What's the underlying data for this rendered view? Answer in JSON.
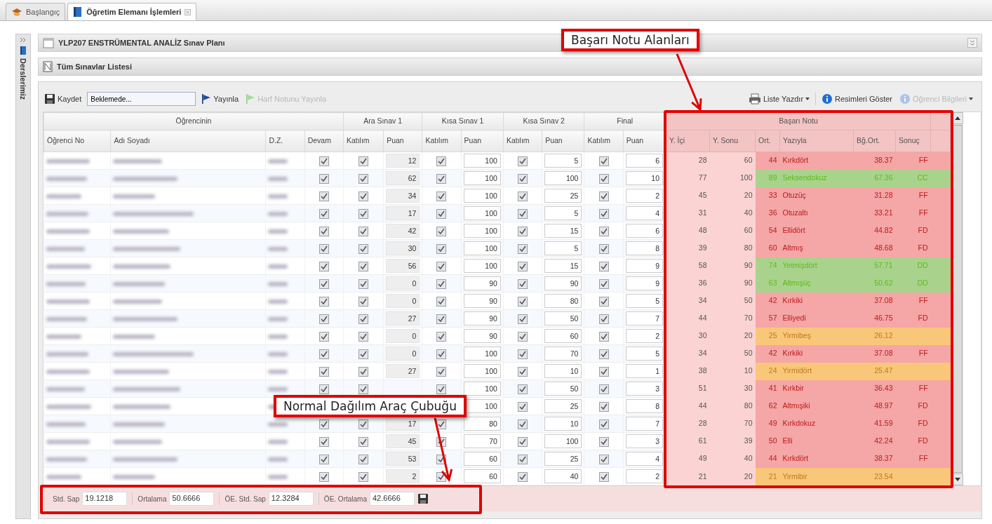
{
  "tabs": [
    {
      "label": "Başlangıç",
      "kind": "home",
      "selected": false,
      "closable": false
    },
    {
      "label": "Öğretim Elemanı İşlemleri",
      "kind": "book",
      "selected": true,
      "closable": true
    }
  ],
  "sidebar": {
    "label": "Derslerimiz"
  },
  "panel": {
    "title": "YLP207 ENSTRÜMENTAL ANALİZ Sınav Planı"
  },
  "subpanel": {
    "title": "Tüm Sınavlar Listesi"
  },
  "toolbar": {
    "left": [
      {
        "kind": "save",
        "label": "Kaydet",
        "disabled": false
      },
      {
        "kind": "status",
        "value": "Beklemede..."
      },
      {
        "kind": "flag",
        "label": "Yayınla",
        "disabled": false
      },
      {
        "kind": "flag",
        "label": "Harf Notunu Yayınla",
        "disabled": true
      }
    ],
    "right": [
      {
        "kind": "print",
        "label": "Liste Yazdır",
        "dropdown": true,
        "disabled": false
      },
      {
        "kind": "info",
        "label": "Resimleri Göster",
        "dropdown": false,
        "disabled": false
      },
      {
        "kind": "info",
        "label": "Öğrenci Bilgileri",
        "dropdown": true,
        "disabled": true
      }
    ]
  },
  "grid": {
    "groups": [
      {
        "label": "Öğrencinin",
        "columns": [
          "Öğrenci No",
          "Adı Soyadı",
          "D.Z.",
          "Devam"
        ]
      },
      {
        "label": "Ara Sınav 1",
        "columns": [
          "Katılım",
          "Puan"
        ]
      },
      {
        "label": "Kısa Sınav 1",
        "columns": [
          "Katılım",
          "Puan"
        ]
      },
      {
        "label": "Kısa Sınav 2",
        "columns": [
          "Katılım",
          "Puan"
        ]
      },
      {
        "label": "Final",
        "columns": [
          "Katılım",
          "Puan"
        ]
      },
      {
        "label": "Başarı Notu",
        "columns": [
          "Y. İçi",
          "Y. Sonu",
          "Ort.",
          "Yazıyla",
          "Bğ.Ort.",
          "Sonuç"
        ]
      }
    ],
    "rows": [
      {
        "checks": {
          "devam": true,
          "ara": true,
          "k1": true,
          "k2": true,
          "final": true
        },
        "scores": {
          "ara": "12",
          "k1": "100",
          "k2": "5",
          "final": "6"
        },
        "y_ici": "28",
        "y_sonu": "60",
        "ort": "44",
        "yaziyla": "Kırkdört",
        "bg_ort": "38.37",
        "sonuc": "FF",
        "color": "#f5a6a6"
      },
      {
        "checks": {
          "devam": true,
          "ara": true,
          "k1": true,
          "k2": true,
          "final": true
        },
        "scores": {
          "ara": "62",
          "k1": "100",
          "k2": "100",
          "final": "10"
        },
        "y_ici": "77",
        "y_sonu": "100",
        "ort": "89",
        "yaziyla": "Seksendokuz",
        "bg_ort": "67.36",
        "sonuc": "CC",
        "color": "#a9d38c"
      },
      {
        "checks": {
          "devam": true,
          "ara": true,
          "k1": true,
          "k2": true,
          "final": true
        },
        "scores": {
          "ara": "34",
          "k1": "100",
          "k2": "25",
          "final": "2"
        },
        "y_ici": "45",
        "y_sonu": "20",
        "ort": "33",
        "yaziyla": "Otuzüç",
        "bg_ort": "31.28",
        "sonuc": "FF",
        "color": "#f5a6a6"
      },
      {
        "checks": {
          "devam": true,
          "ara": true,
          "k1": true,
          "k2": true,
          "final": true
        },
        "scores": {
          "ara": "17",
          "k1": "100",
          "k2": "5",
          "final": "4"
        },
        "y_ici": "31",
        "y_sonu": "40",
        "ort": "36",
        "yaziyla": "Otuzaltı",
        "bg_ort": "33.21",
        "sonuc": "FF",
        "color": "#f5a6a6"
      },
      {
        "checks": {
          "devam": true,
          "ara": true,
          "k1": true,
          "k2": true,
          "final": true
        },
        "scores": {
          "ara": "42",
          "k1": "100",
          "k2": "15",
          "final": "6"
        },
        "y_ici": "48",
        "y_sonu": "60",
        "ort": "54",
        "yaziyla": "Ellidört",
        "bg_ort": "44.82",
        "sonuc": "FD",
        "color": "#f5a6a6"
      },
      {
        "checks": {
          "devam": true,
          "ara": true,
          "k1": true,
          "k2": true,
          "final": true
        },
        "scores": {
          "ara": "30",
          "k1": "100",
          "k2": "5",
          "final": "8"
        },
        "y_ici": "39",
        "y_sonu": "80",
        "ort": "60",
        "yaziyla": "Altmış",
        "bg_ort": "48.68",
        "sonuc": "FD",
        "color": "#f5a6a6"
      },
      {
        "checks": {
          "devam": true,
          "ara": true,
          "k1": true,
          "k2": true,
          "final": true
        },
        "scores": {
          "ara": "56",
          "k1": "100",
          "k2": "15",
          "final": "9"
        },
        "y_ici": "58",
        "y_sonu": "90",
        "ort": "74",
        "yaziyla": "Yetmişdört",
        "bg_ort": "57.71",
        "sonuc": "DD",
        "color": "#a9d38c"
      },
      {
        "checks": {
          "devam": true,
          "ara": true,
          "k1": true,
          "k2": true,
          "final": true
        },
        "scores": {
          "ara": "0",
          "k1": "90",
          "k2": "90",
          "final": "9"
        },
        "y_ici": "36",
        "y_sonu": "90",
        "ort": "63",
        "yaziyla": "Altmışüç",
        "bg_ort": "50.62",
        "sonuc": "DD",
        "color": "#a9d38c"
      },
      {
        "checks": {
          "devam": true,
          "ara": true,
          "k1": true,
          "k2": true,
          "final": true
        },
        "scores": {
          "ara": "0",
          "k1": "90",
          "k2": "80",
          "final": "5"
        },
        "y_ici": "34",
        "y_sonu": "50",
        "ort": "42",
        "yaziyla": "Kırkiki",
        "bg_ort": "37.08",
        "sonuc": "FF",
        "color": "#f5a6a6"
      },
      {
        "checks": {
          "devam": true,
          "ara": true,
          "k1": true,
          "k2": true,
          "final": true
        },
        "scores": {
          "ara": "27",
          "k1": "90",
          "k2": "50",
          "final": "7"
        },
        "y_ici": "44",
        "y_sonu": "70",
        "ort": "57",
        "yaziyla": "Elliyedi",
        "bg_ort": "46.75",
        "sonuc": "FD",
        "color": "#f5a6a6"
      },
      {
        "checks": {
          "devam": true,
          "ara": true,
          "k1": true,
          "k2": true,
          "final": true
        },
        "scores": {
          "ara": "0",
          "k1": "90",
          "k2": "60",
          "final": "2"
        },
        "y_ici": "30",
        "y_sonu": "20",
        "ort": "25",
        "yaziyla": "Yirmibeş",
        "bg_ort": "26.12",
        "color": "#f9c77a"
      },
      {
        "checks": {
          "devam": true,
          "ara": true,
          "k1": true,
          "k2": true,
          "final": true
        },
        "scores": {
          "ara": "0",
          "k1": "100",
          "k2": "70",
          "final": "5"
        },
        "y_ici": "34",
        "y_sonu": "50",
        "ort": "42",
        "yaziyla": "Kırkiki",
        "bg_ort": "37.08",
        "sonuc": "FF",
        "color": "#f5a6a6"
      },
      {
        "checks": {
          "devam": true,
          "ara": true,
          "k1": true,
          "k2": true,
          "final": true
        },
        "scores": {
          "ara": "27",
          "k1": "100",
          "k2": "10",
          "final": "1"
        },
        "y_ici": "38",
        "y_sonu": "10",
        "ort": "24",
        "yaziyla": "Yirmidört",
        "bg_ort": "25.47",
        "color": "#f9c77a"
      },
      {
        "checks": {
          "devam": true,
          "ara": true,
          "k1": true,
          "k2": true,
          "final": true
        },
        "scores": {
          "k1": "100",
          "k2": "50",
          "final": "3"
        },
        "y_ici": "51",
        "y_sonu": "30",
        "ort": "41",
        "yaziyla": "Kırkbir",
        "bg_ort": "36.43",
        "sonuc": "FF",
        "color": "#f5a6a6"
      },
      {
        "checks": {
          "k2": true,
          "final": true
        },
        "scores": {
          "k1": "100",
          "k2": "25",
          "final": "8"
        },
        "y_ici": "44",
        "y_sonu": "80",
        "ort": "62",
        "yaziyla": "Altmışiki",
        "bg_ort": "48.97",
        "sonuc": "FD",
        "color": "#f5a6a6"
      },
      {
        "checks": {
          "devam": true,
          "ara": true,
          "k1": true,
          "k2": true,
          "final": true
        },
        "scores": {
          "ara": "17",
          "k1": "80",
          "k2": "10",
          "final": "7"
        },
        "y_ici": "28",
        "y_sonu": "70",
        "ort": "49",
        "yaziyla": "Kırkdokuz",
        "bg_ort": "41.59",
        "sonuc": "FD",
        "color": "#f5a6a6"
      },
      {
        "checks": {
          "devam": true,
          "ara": true,
          "k1": true,
          "k2": true,
          "final": true
        },
        "scores": {
          "ara": "45",
          "k1": "70",
          "k2": "100",
          "final": "3"
        },
        "y_ici": "61",
        "y_sonu": "39",
        "ort": "50",
        "yaziyla": "Elli",
        "bg_ort": "42.24",
        "sonuc": "FD",
        "color": "#f5a6a6"
      },
      {
        "checks": {
          "devam": true,
          "ara": true,
          "k1": true,
          "k2": true,
          "final": true
        },
        "scores": {
          "ara": "53",
          "k1": "60",
          "k2": "25",
          "final": "4"
        },
        "y_ici": "49",
        "y_sonu": "40",
        "ort": "44",
        "yaziyla": "Kırkdört",
        "bg_ort": "38.37",
        "sonuc": "FF",
        "color": "#f5a6a6"
      },
      {
        "checks": {
          "devam": true,
          "ara": true,
          "k1": true,
          "k2": true,
          "final": true
        },
        "scores": {
          "ara": "2",
          "k1": "60",
          "k2": "40",
          "final": "2"
        },
        "y_ici": "21",
        "y_sonu": "20",
        "ort": "21",
        "yaziyla": "Yirmibir",
        "bg_ort": "23.54",
        "color": "#f9c77a"
      }
    ]
  },
  "stats": [
    {
      "label": "Std. Sap",
      "value": "19.1218"
    },
    {
      "label": "Ortalama",
      "value": "50.6666"
    },
    {
      "label": "ÖE. Std. Sap",
      "value": "12.3284"
    },
    {
      "label": "ÖE. Ortalama",
      "value": "42.6666"
    }
  ],
  "annotations": [
    {
      "text": "Başarı Notu Alanları",
      "kind": "results"
    },
    {
      "text": "Normal Dağılım Araç Çubuğu",
      "kind": "stats"
    }
  ]
}
